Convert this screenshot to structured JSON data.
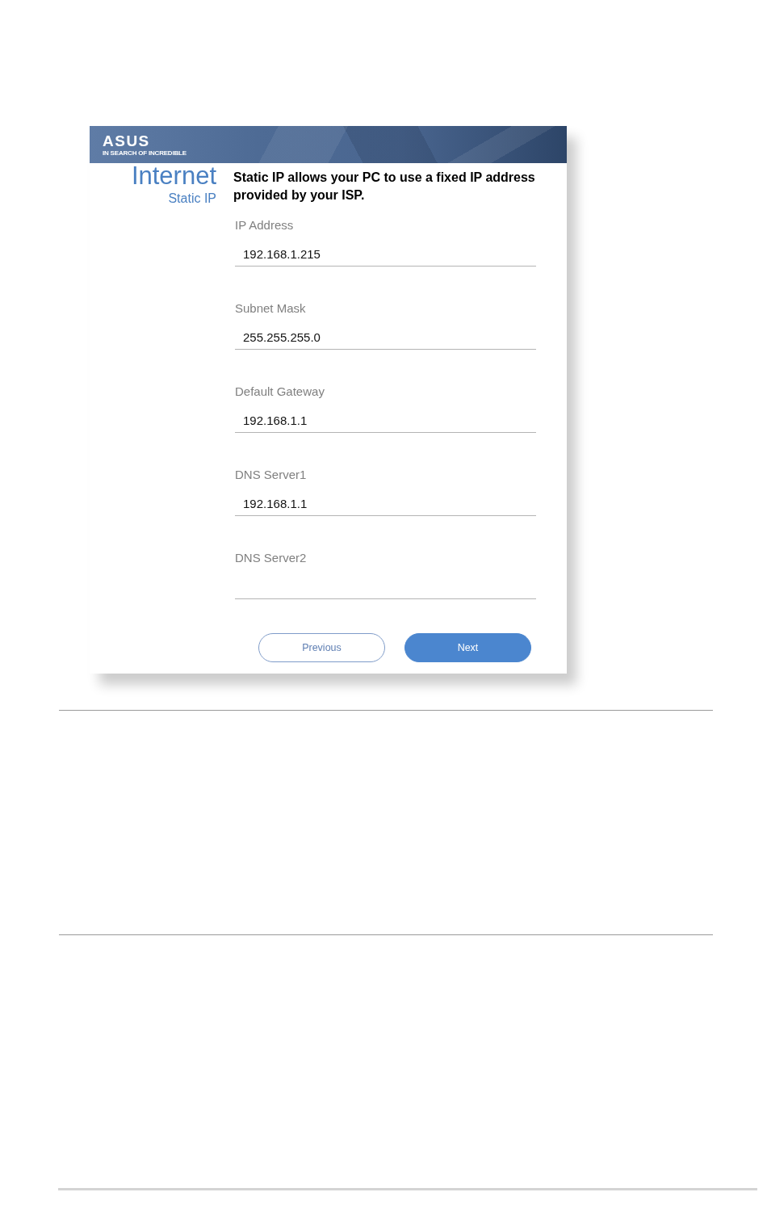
{
  "header": {
    "logo": "ASUS",
    "tagline": "IN SEARCH OF INCREDIBLE"
  },
  "heading": {
    "title": "Internet",
    "subtitle": "Static IP"
  },
  "description": "Static IP allows your PC to use a fixed IP address provided by your ISP.",
  "fields": [
    {
      "label": "IP Address",
      "value": "192.168.1.215"
    },
    {
      "label": "Subnet Mask",
      "value": "255.255.255.0"
    },
    {
      "label": "Default Gateway",
      "value": "192.168.1.1"
    },
    {
      "label": "DNS Server1",
      "value": "192.168.1.1"
    },
    {
      "label": "DNS Server2"
    }
  ],
  "buttons": [
    {
      "label": "Previous",
      "kind": "secondary"
    },
    {
      "label": "Next",
      "kind": "primary"
    }
  ]
}
